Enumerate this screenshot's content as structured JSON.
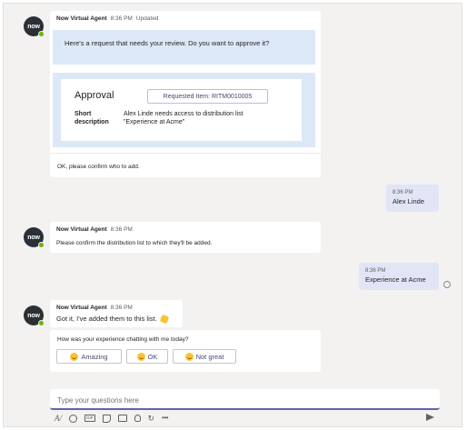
{
  "bot": {
    "avatar_text": "now",
    "name": "Now Virtual Agent"
  },
  "messages": {
    "m1": {
      "time": "8:36 PM",
      "updated": "Updated",
      "intro": "Here's a request that needs your review. Do you want to approve it?",
      "approval_title": "Approval",
      "requested_item": "Requested Item: RITM0010005",
      "short_desc_label_1": "Short",
      "short_desc_label_2": "description",
      "short_desc_value_1": "Alex Linde needs access to distribution list",
      "short_desc_value_2": "\"Experience at Acme\"",
      "followup": "OK, please confirm who to add."
    },
    "u1": {
      "time": "8:36 PM",
      "text": "Alex Linde"
    },
    "m2": {
      "time": "8:36 PM",
      "text": "Please confirm the distribution list to which they'll be added."
    },
    "u2": {
      "time": "8:36 PM",
      "text": "Experience at Acme"
    },
    "m3": {
      "time": "8:36 PM",
      "text": "Got it, I've added them to this list.",
      "feedback_prompt": "How was your experience chatting with me today?",
      "options": [
        "Amazing",
        "OK",
        "Not great"
      ]
    }
  },
  "compose": {
    "placeholder": "Type your questions here",
    "toolbar_icons": [
      "format-icon",
      "emoji-icon",
      "gif-icon",
      "sticker-icon",
      "meet-icon",
      "praise-icon",
      "loop-icon",
      "more-icon"
    ],
    "send_icon": "send-icon"
  }
}
